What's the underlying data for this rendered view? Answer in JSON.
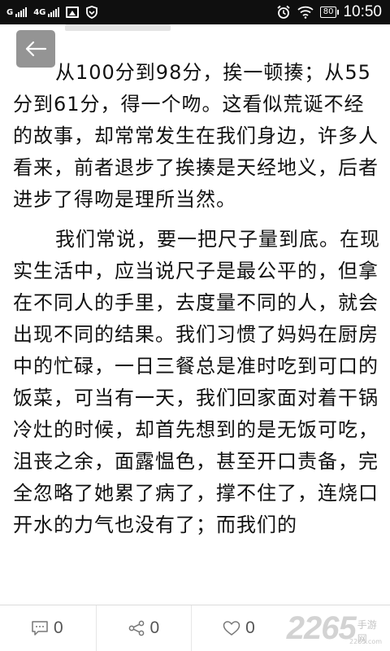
{
  "status_bar": {
    "sim1_label": "G",
    "sim2_label": "4G",
    "battery": "80",
    "time": "10:50"
  },
  "article": {
    "paragraphs": [
      "从100分到98分，挨一顿揍；从55分到61分，得一个吻。这看似荒诞不经的故事，却常常发生在我们身边，许多人看来，前者退步了挨揍是天经地义，后者进步了得吻是理所当然。",
      "我们常说，要一把尺子量到底。在现实生活中，应当说尺子是最公平的，但拿在不同人的手里，去度量不同的人，就会出现不同的结果。我们习惯了妈妈在厨房中的忙碌，一日三餐总是准时吃到可口的饭菜，可当有一天，我们回家面对着干锅冷灶的时候，却首先想到的是无饭可吃，沮丧之余，面露愠色，甚至开口责备，完全忽略了她累了病了，撑不住了，连烧口开水的力气也没有了；而我们的"
    ]
  },
  "actions": {
    "comment_count": "0",
    "share_count": "0",
    "like_count": "0"
  },
  "brand": {
    "number": "2265",
    "name": "手游网",
    "site": "2265.com"
  }
}
